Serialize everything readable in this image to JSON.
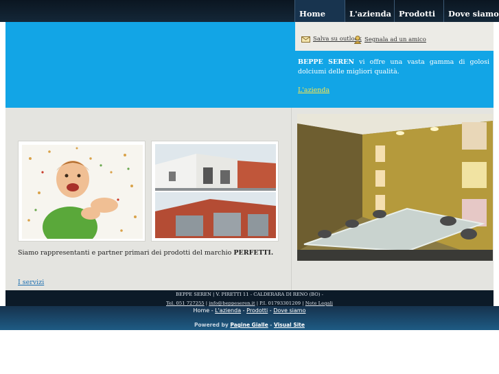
{
  "nav": {
    "items": [
      {
        "label": "Home"
      },
      {
        "label": "L'azienda"
      },
      {
        "label": "Prodotti"
      },
      {
        "label": "Dove siamo"
      }
    ]
  },
  "actions": {
    "outlook": "Salva su outlook",
    "friend": "Segnala ad un amico"
  },
  "intro": {
    "name": "BEPPE SEREN",
    "text": " vi offre una vasta gamma di golosi dolciumi delle migliori qualità.",
    "link": "L'azienda"
  },
  "main": {
    "partner_text": "Siamo rappresentanti e partner primari dei prodotti del marchio ",
    "brand": "PERFETTI.",
    "servizi": "I servizi"
  },
  "footer": {
    "line1": "BEPPE SEREN | V. PIRETTI 11 - CALDERARA DI RENO (BO) -",
    "phone": "Tel. 051 727255",
    "email": "info@beppeseren.it",
    "piva": " | P.I. 01793301209 | ",
    "legal": "Note Legali"
  },
  "bottom": {
    "links": [
      {
        "label": "Home"
      },
      {
        "label": "L'azienda"
      },
      {
        "label": "Prodotti"
      },
      {
        "label": "Dove siamo"
      }
    ],
    "sep": " - ",
    "powered": "Powered by ",
    "pg": "Pagine Gialle",
    "dash": " - ",
    "vs": "Visual Site"
  },
  "colors": {
    "accent": "#12a5e6",
    "nav_bg": "#0b1621",
    "footer": "#0c1a28"
  }
}
